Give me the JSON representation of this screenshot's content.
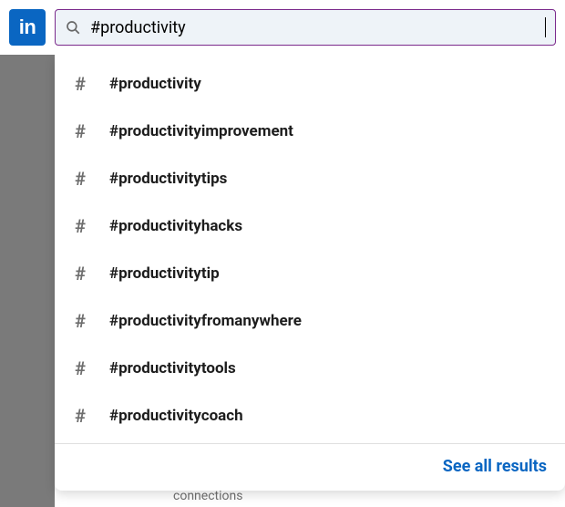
{
  "brand": {
    "logo_text": "in",
    "accent_color": "#0a66c2"
  },
  "search": {
    "value": "#productivity",
    "icon_name": "search-icon"
  },
  "suggestions": [
    {
      "label": "#productivity"
    },
    {
      "label": "#productivityimprovement"
    },
    {
      "label": "#productivitytips"
    },
    {
      "label": "#productivityhacks"
    },
    {
      "label": "#productivitytip"
    },
    {
      "label": "#productivityfromanywhere"
    },
    {
      "label": "#productivitytools"
    },
    {
      "label": "#productivitycoach"
    }
  ],
  "see_all_label": "See all results",
  "obscured_text": "connections"
}
